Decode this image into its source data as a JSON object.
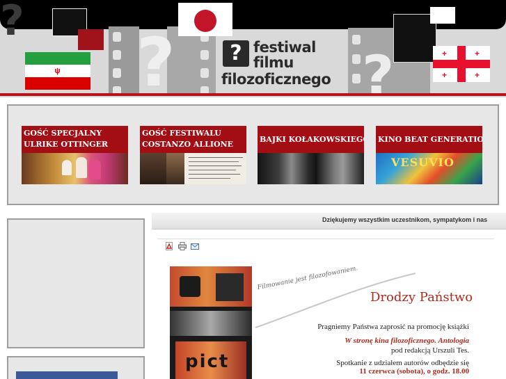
{
  "site": {
    "logo": {
      "question_mark": "?",
      "line1": "festiwal",
      "line2": "filmu",
      "line3": "filozoficznego"
    }
  },
  "guests": [
    {
      "line1": "Gość specjalny",
      "line2": "Ulrike Ottinger"
    },
    {
      "line1": "Gość festiwalu",
      "line2": "Costanzo Allione"
    },
    {
      "line1": "Bajki Kołakowskiego",
      "line2": ""
    },
    {
      "line1": "Kino Beat Generation",
      "line2": ""
    }
  ],
  "ticker": {
    "text": "Dziękujemy wszystkim uczestnikom, sympatykom i nas"
  },
  "toolbar": {
    "pdf_icon": "pdf-icon",
    "print_icon": "print-icon",
    "email_icon": "email-icon"
  },
  "article": {
    "tagline": "Filmowanie jest filozofowaniem.",
    "greeting": "Drodzy Państwo",
    "line1": "Pragniemy Państwa zaprosić na promocję książki",
    "line2": "W stronę kina filozoficznego. Antologia",
    "line3": "pod redakcją Urszuli Tes.",
    "line4": "Spotkanie z udziałem autorów odbędzie się",
    "line5": "11 czerwca (sobota), o godz. 18.00"
  },
  "colors": {
    "brand_red": "#b7131a",
    "caption_red": "#a30e15",
    "panel_gray": "#e7e7e7",
    "border_gray": "#9d9d9d"
  }
}
